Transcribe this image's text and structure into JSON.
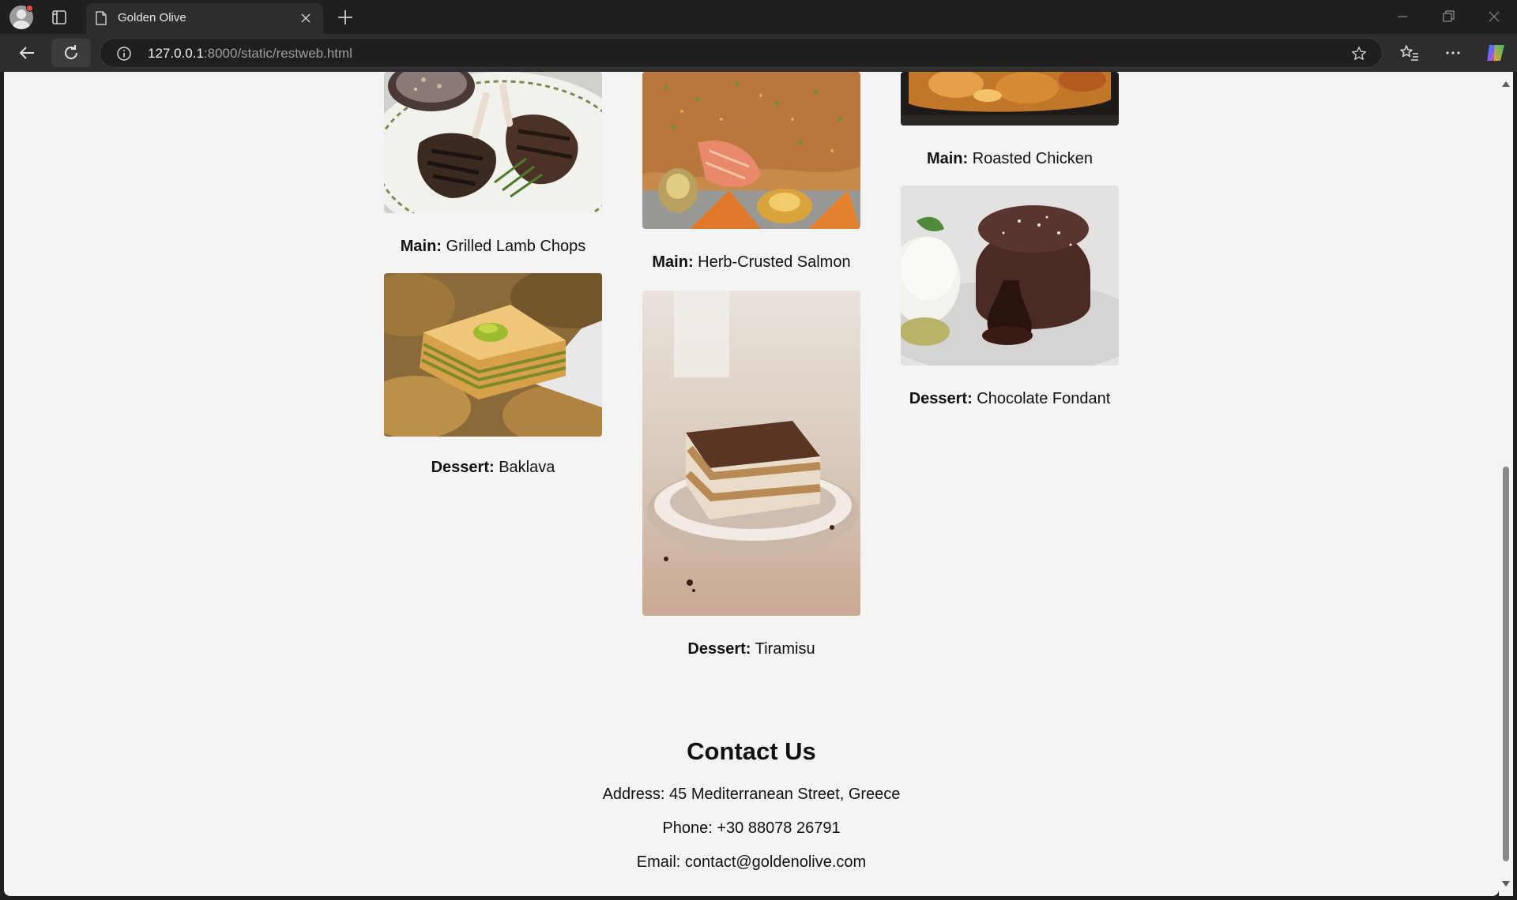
{
  "browser": {
    "tab_title": "Golden Olive",
    "url_host": "127.0.0.1",
    "url_rest": ":8000/static/restweb.html"
  },
  "menu": [
    {
      "course": "Main:",
      "name": "Grilled Lamb Chops",
      "image": "grilled-lamb-chops-photo"
    },
    {
      "course": "Main:",
      "name": "Herb-Crusted Salmon",
      "image": "herb-crusted-salmon-photo"
    },
    {
      "course": "Main:",
      "name": "Roasted Chicken",
      "image": "roasted-chicken-photo"
    },
    {
      "course": "Dessert:",
      "name": "Baklava",
      "image": "baklava-photo"
    },
    {
      "course": "Dessert:",
      "name": "Tiramisu",
      "image": "tiramisu-photo"
    },
    {
      "course": "Dessert:",
      "name": "Chocolate Fondant",
      "image": "chocolate-fondant-photo"
    }
  ],
  "contact": {
    "heading": "Contact Us",
    "address": "Address: 45 Mediterranean Street, Greece",
    "phone": "Phone: +30 88078 26791",
    "email": "Email: contact@goldenolive.com"
  }
}
